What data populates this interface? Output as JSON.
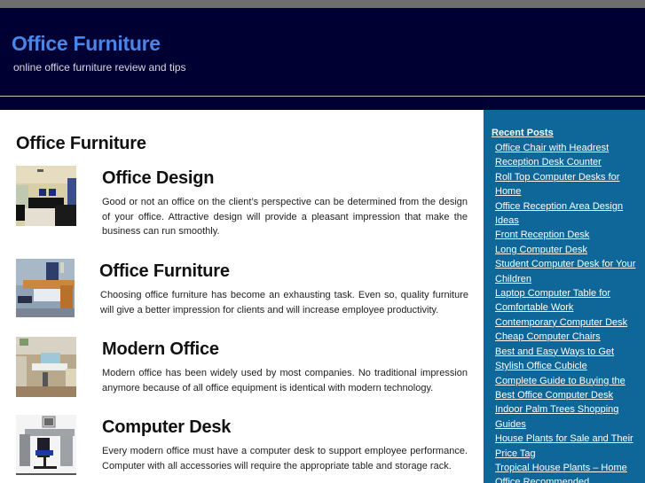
{
  "header": {
    "site_title": "Office Furniture",
    "tagline": "online office furniture review and tips"
  },
  "main": {
    "heading": "Office Furniture",
    "posts": [
      {
        "title": "Office Design",
        "thumbnail": "office-lobby-photo",
        "text": "Good or not an office on the client’s perspective can be determined from the design of your office. Attractive design will provide a pleasant impression that make the business can run smoothly."
      },
      {
        "title": "Office Furniture",
        "thumbnail": "office-desk-photo",
        "text": "Choosing office furniture has become an exhausting task. Even so, quality furniture will give a better impression for clients and will increase employee productivity."
      },
      {
        "title": "Modern Office",
        "thumbnail": "modern-cubicle-photo",
        "text": "Modern office has been widely used by most companies. No traditional impression anymore because of all office equipment is identical with modern technology."
      },
      {
        "title": "Computer Desk",
        "thumbnail": "computer-desk-photo",
        "text": "Every modern office must have a computer desk to support employee performance. Computer with all accessories will require the appropriate table and storage rack."
      }
    ]
  },
  "sidebar": {
    "heading": "Recent Posts",
    "links": [
      "Office Chair with Headrest",
      "Reception Desk Counter",
      "Roll Top Computer Desks for Home",
      "Office Reception Area Design Ideas",
      "Front Reception Desk",
      "Long Computer Desk",
      "Student Computer Desk for Your Children",
      "Laptop Computer Table for Comfortable Work",
      "Contemporary Computer Desk",
      "Cheap Computer Chairs",
      "Best and Easy Ways to Get Stylish Office Cubicle",
      "Complete Guide to Buying the Best Office Computer Desk",
      "Indoor Palm Trees Shopping Guides",
      "House Plants for Sale and Their Price Tag",
      "Tropical House Plants – Home Office Recommended"
    ]
  },
  "colors": {
    "header_bg": "#000033",
    "title_blue": "#4a86e8",
    "sidebar_bg": "#0e6699",
    "topbar": "#6e6e6e"
  }
}
